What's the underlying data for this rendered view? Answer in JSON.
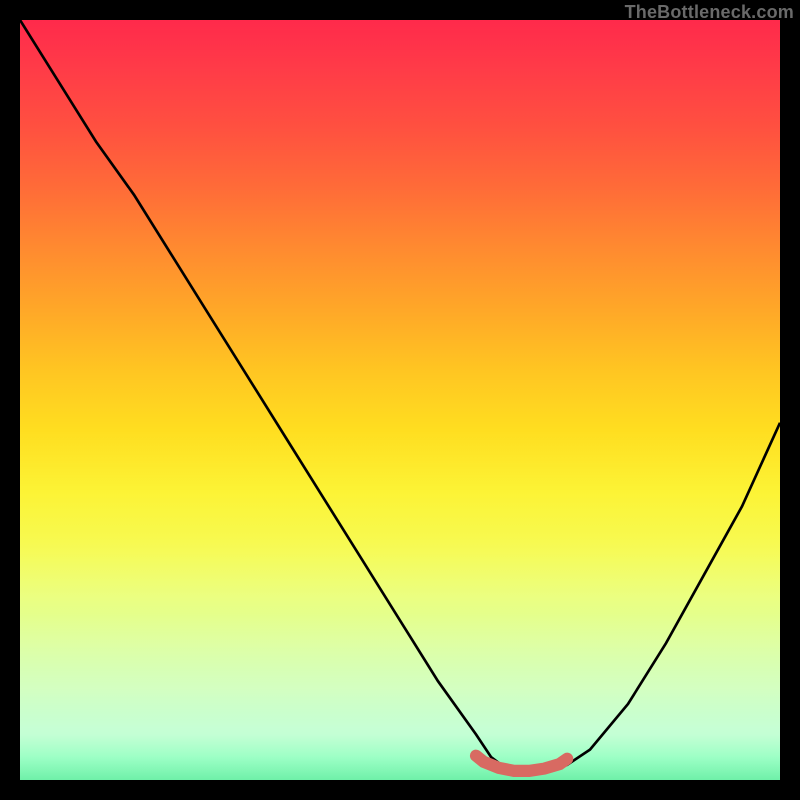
{
  "watermark": "TheBottleneck.com",
  "chart_data": {
    "type": "line",
    "title": "",
    "xlabel": "",
    "ylabel": "",
    "xlim": [
      0,
      100
    ],
    "ylim": [
      0,
      100
    ],
    "grid": false,
    "legend": false,
    "series": [
      {
        "name": "bottleneck-curve",
        "color": "#000000",
        "x": [
          0,
          5,
          10,
          15,
          20,
          25,
          30,
          35,
          40,
          45,
          50,
          55,
          60,
          62,
          64,
          66,
          68,
          70,
          72,
          75,
          80,
          85,
          90,
          95,
          100
        ],
        "y": [
          100,
          92,
          84,
          77,
          69,
          61,
          53,
          45,
          37,
          29,
          21,
          13,
          6,
          3,
          1.5,
          1,
          1,
          1.2,
          2,
          4,
          10,
          18,
          27,
          36,
          47
        ]
      },
      {
        "name": "optimal-range-marker",
        "color": "#d86a62",
        "x": [
          60,
          61,
          63,
          65,
          67,
          69,
          71,
          72
        ],
        "y": [
          3.2,
          2.4,
          1.6,
          1.2,
          1.2,
          1.5,
          2.1,
          2.8
        ]
      }
    ],
    "annotations": [
      {
        "text": "TheBottleneck.com",
        "position": "top-right"
      }
    ]
  },
  "colors": {
    "black": "#000000",
    "marker": "#d86a62"
  }
}
